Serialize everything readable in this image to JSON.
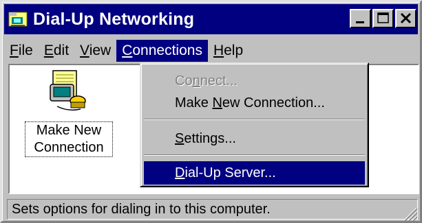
{
  "window": {
    "title": "Dial-Up Networking"
  },
  "menubar": {
    "items": [
      {
        "pre": "",
        "ul": "F",
        "post": "ile"
      },
      {
        "pre": "",
        "ul": "E",
        "post": "dit"
      },
      {
        "pre": "",
        "ul": "V",
        "post": "iew"
      },
      {
        "pre": "",
        "ul": "C",
        "post": "onnections"
      },
      {
        "pre": "",
        "ul": "H",
        "post": "elp"
      }
    ]
  },
  "client": {
    "icon_label_line1": "Make New",
    "icon_label_line2": "Connection"
  },
  "dropdown": {
    "connect": {
      "pre": "Co",
      "ul": "n",
      "post": "nect..."
    },
    "make_new": {
      "pre": "Make ",
      "ul": "N",
      "post": "ew Connection..."
    },
    "settings": {
      "pre": "",
      "ul": "S",
      "post": "ettings..."
    },
    "dialup_server": {
      "pre": "",
      "ul": "D",
      "post": "ial-Up Server..."
    }
  },
  "statusbar": {
    "text": "Sets options for dialing in to this computer."
  },
  "icons": {
    "app": "dialup-networking-icon",
    "minimize": "minimize-icon",
    "maximize": "maximize-icon",
    "close": "close-icon",
    "file": "make-new-connection-icon",
    "grip": "resize-grip-icon"
  },
  "colors": {
    "titlebar": "#000080",
    "face": "#c0c0c0",
    "highlight": "#000080"
  }
}
